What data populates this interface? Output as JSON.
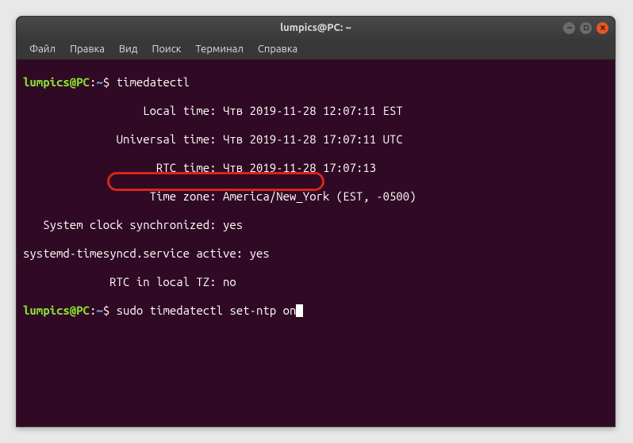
{
  "window": {
    "title": "lumpics@PC: ~"
  },
  "menu": {
    "file": "Файл",
    "edit": "Правка",
    "view": "Вид",
    "search": "Поиск",
    "terminal": "Терминал",
    "help": "Справка"
  },
  "prompt": {
    "userhost": "lumpics@PC",
    "colon": ":",
    "path": "~",
    "symbol": "$"
  },
  "commands": {
    "cmd1": "timedatectl",
    "cmd2": "sudo timedatectl set-ntp on"
  },
  "output": {
    "l1": "                  Local time: Чтв 2019-11-28 12:07:11 EST",
    "l2": "              Universal time: Чтв 2019-11-28 17:07:11 UTC",
    "l3": "                    RTC time: Чтв 2019-11-28 17:07:13",
    "l4": "                   Time zone: America/New_York (EST, -0500)",
    "l5": "   System clock synchronized: yes",
    "l6": "systemd-timesyncd.service active: yes",
    "l7": "             RTC in local TZ: no"
  }
}
